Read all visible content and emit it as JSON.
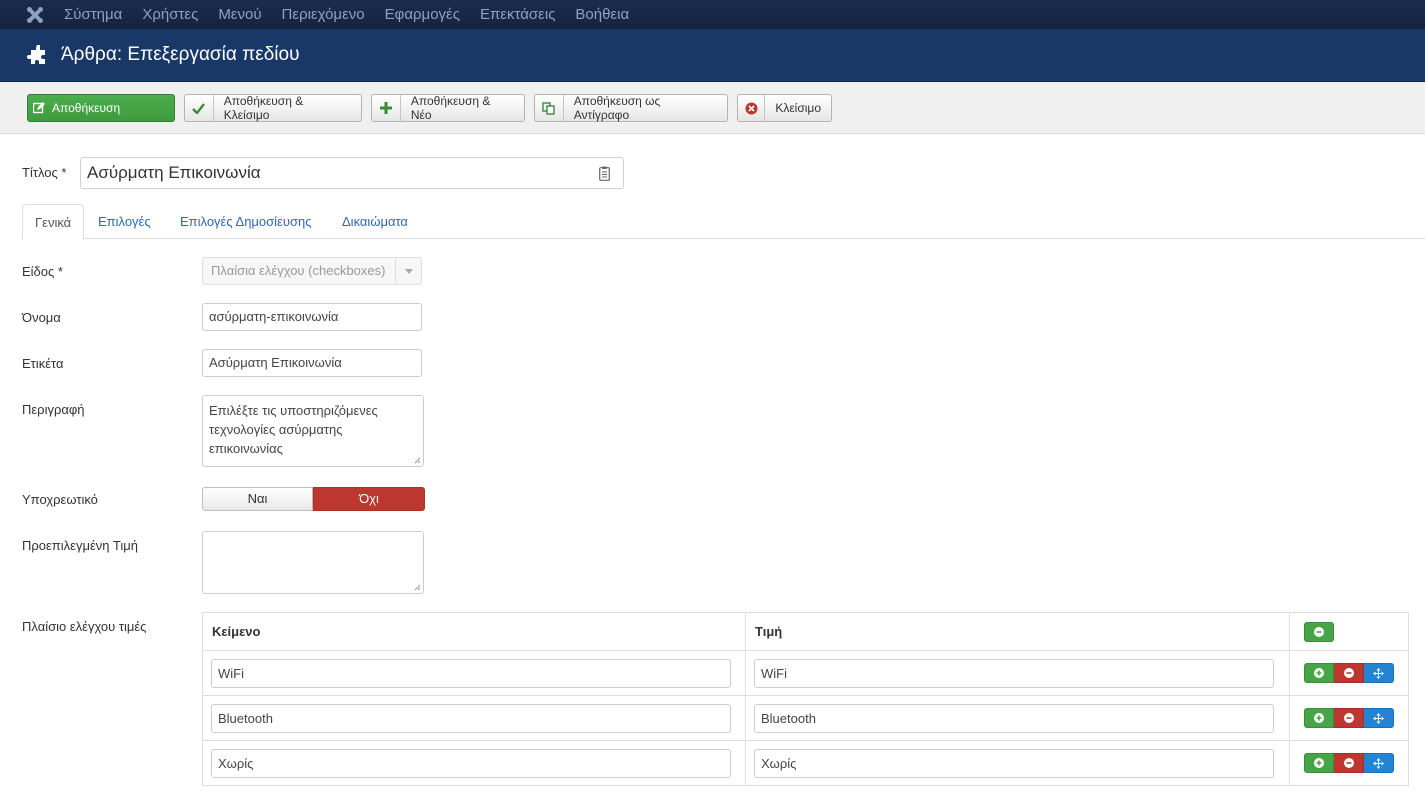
{
  "topnav": {
    "items": [
      "Σύστημα",
      "Χρήστες",
      "Μενού",
      "Περιεχόμενο",
      "Εφαρμογές",
      "Επεκτάσεις",
      "Βοήθεια"
    ]
  },
  "header": {
    "title": "Άρθρα: Επεξεργασία πεδίου"
  },
  "toolbar": {
    "save": "Αποθήκευση",
    "save_close": "Αποθήκευση & Κλείσιμο",
    "save_new": "Αποθήκευση & Νέο",
    "save_copy": "Αποθήκευση ως Αντίγραφο",
    "close": "Κλείσιμο"
  },
  "title_field": {
    "label": "Τίτλος *",
    "value": "Ασύρματη Επικοινωνία"
  },
  "tabs": [
    "Γενικά",
    "Επιλογές",
    "Επιλογές Δημοσίευσης",
    "Δικαιώματα"
  ],
  "form": {
    "type": {
      "label": "Είδος *",
      "value": "Πλαίσια ελέγχου (checkboxes)"
    },
    "name": {
      "label": "Όνομα",
      "value": "ασύρματη-επικοινωνία"
    },
    "field_label": {
      "label": "Ετικέτα",
      "value": "Ασύρματη Επικοινωνία"
    },
    "description": {
      "label": "Περιγραφή",
      "value": "Επιλέξτε τις υποστηριζόμενες τεχνολογίες ασύρματης επικοινωνίας"
    },
    "required": {
      "label": "Υποχρεωτικό",
      "yes": "Ναι",
      "no": "Όχι",
      "selected": "no"
    },
    "default_value": {
      "label": "Προεπιλεγμένη Τιμή",
      "value": ""
    },
    "options": {
      "label": "Πλαίσιο ελέγχου τιμές",
      "col_text": "Κείμενο",
      "col_value": "Τιμή",
      "rows": [
        {
          "text": "WiFi",
          "value": "WiFi"
        },
        {
          "text": "Bluetooth",
          "value": "Bluetooth"
        },
        {
          "text": "Χωρίς",
          "value": "Χωρίς"
        }
      ]
    }
  },
  "colors": {
    "navbar": "#1b2c4d",
    "header": "#1a3867",
    "save": "#46a546",
    "danger": "#bd362f",
    "primary": "#2384d3",
    "link": "#2a69b8"
  }
}
